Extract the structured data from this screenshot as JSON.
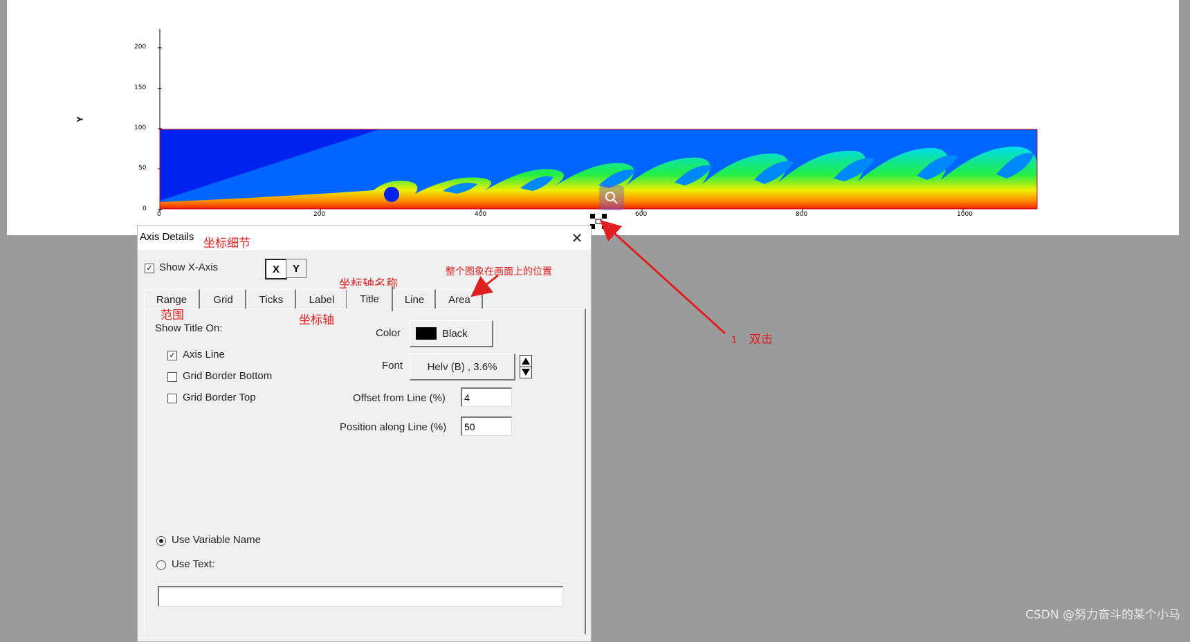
{
  "plot": {
    "y_axis_label": "Y",
    "y_ticks": [
      "200",
      "150",
      "100",
      "50",
      "0"
    ],
    "x_ticks": [
      "0",
      "200",
      "400",
      "600",
      "800",
      "1000"
    ],
    "field_colors": {
      "deep": "#0022ee",
      "mid": "#0066ff",
      "cyan": "#00ddee",
      "green": "#22ee44",
      "yellow": "#eeee00",
      "orange": "#ff8800",
      "red": "#ee2200"
    }
  },
  "dialog": {
    "title": "Axis Details",
    "show_axis_label": "Show X-Axis",
    "show_axis_checked": true,
    "axis_buttons": [
      "X",
      "Y"
    ],
    "tabs": [
      "Range",
      "Grid",
      "Ticks",
      "Label",
      "Title",
      "Line",
      "Area"
    ],
    "active_tab": "Title",
    "show_title_on_label": "Show Title On:",
    "checkboxes": [
      {
        "label": "Axis Line",
        "checked": true
      },
      {
        "label": "Grid Border Bottom",
        "checked": false
      },
      {
        "label": "Grid Border Top",
        "checked": false
      }
    ],
    "color_label": "Color",
    "color_value": "Black",
    "font_label": "Font",
    "font_value": "Helv (B) , 3.6%",
    "offset_label": "Offset from Line (%)",
    "offset_value": "4",
    "position_label": "Position along Line (%)",
    "position_value": "50",
    "radio_options": [
      {
        "label": "Use Variable Name",
        "checked": true
      },
      {
        "label": "Use Text:",
        "checked": false
      }
    ],
    "text_value": ""
  },
  "annotations": {
    "axis_details": "坐标细节",
    "axis_title": "坐标轴名称",
    "area_note": "整个图象在画面上的位置",
    "range": "范围",
    "label": "坐标轴",
    "step_number": "1",
    "double_click": "双击",
    "accent_color": "#e02020"
  },
  "watermark": "CSDN @努力奋斗的某个小马"
}
